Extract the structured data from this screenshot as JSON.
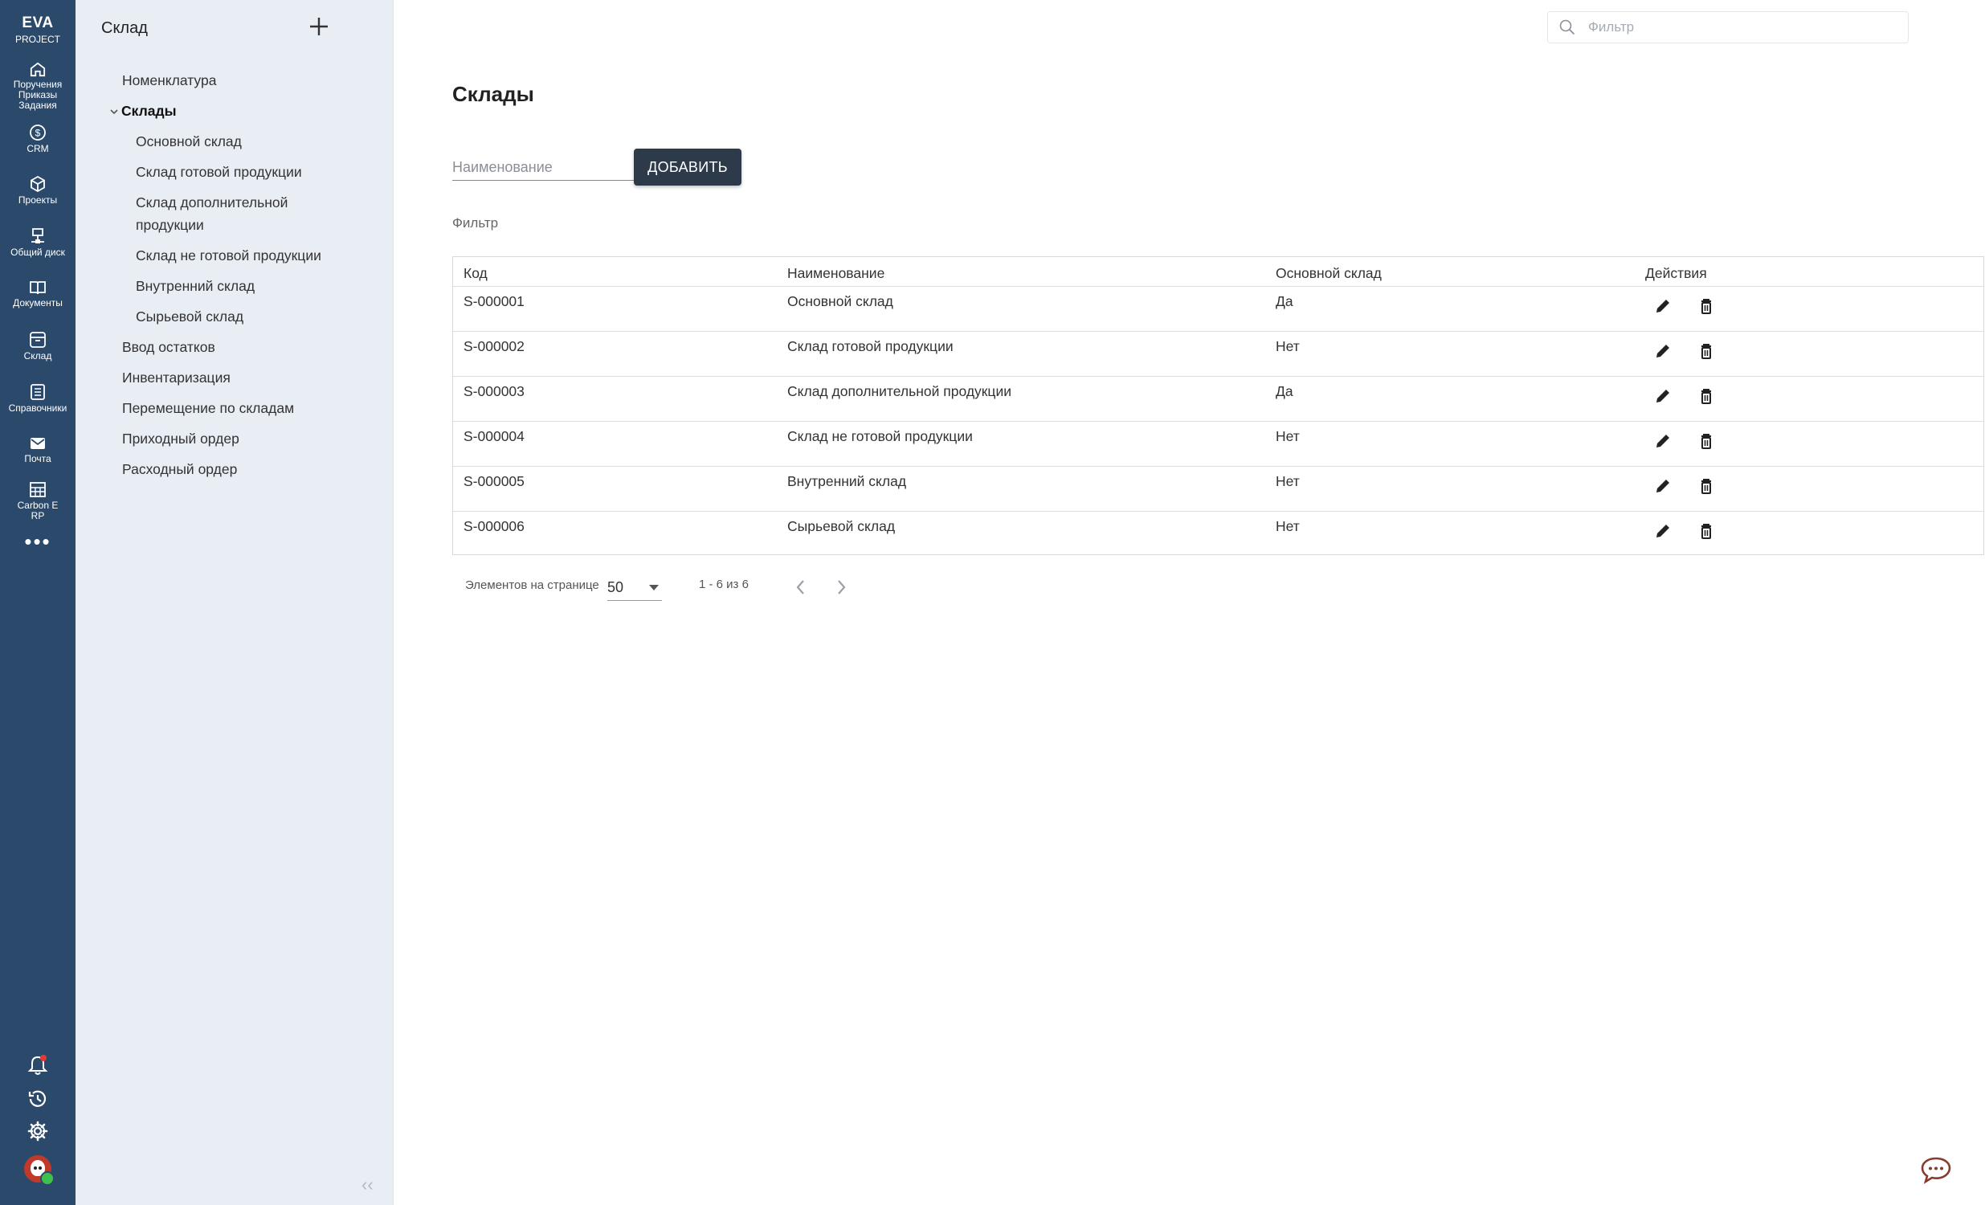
{
  "brand": {
    "line1": "EVA",
    "line2": "PROJECT"
  },
  "rail": [
    {
      "label": "Поручения Приказы Задания",
      "icon": "home-icon"
    },
    {
      "label": "CRM",
      "icon": "dollar-icon"
    },
    {
      "label": "Проекты",
      "icon": "cube-icon"
    },
    {
      "label": "Общий диск",
      "icon": "network-drive-icon"
    },
    {
      "label": "Документы",
      "icon": "book-icon"
    },
    {
      "label": "Склад",
      "icon": "warehouse-icon"
    },
    {
      "label": "Справочники",
      "icon": "reference-book-icon"
    },
    {
      "label": "Почта",
      "icon": "mail-icon"
    },
    {
      "label": "Carbon E RP",
      "icon": "building-icon"
    }
  ],
  "sidebar": {
    "title": "Склад",
    "items": [
      {
        "label": "Номенклатура"
      },
      {
        "label": "Склады"
      },
      {
        "label": "Основной склад"
      },
      {
        "label": "Склад готовой продукции"
      },
      {
        "label": "Склад дополнительной продукции"
      },
      {
        "label": "Склад не готовой продукции"
      },
      {
        "label": "Внутренний склад"
      },
      {
        "label": "Сырьевой склад"
      },
      {
        "label": "Ввод остатков"
      },
      {
        "label": "Инвентаризация"
      },
      {
        "label": "Перемещение по складам"
      },
      {
        "label": "Приходный ордер"
      },
      {
        "label": "Расходный ордер"
      }
    ],
    "collapse": "‹‹"
  },
  "search": {
    "placeholder": "Фильтр"
  },
  "main": {
    "title": "Склады",
    "name_placeholder": "Наименование",
    "add_button": "ДОБАВИТЬ",
    "filter_label": "Фильтр"
  },
  "table": {
    "headers": [
      "Код",
      "Наименование",
      "Основной склад",
      "Действия"
    ],
    "rows": [
      {
        "code": "S-000001",
        "name": "Основной склад",
        "main": "Да"
      },
      {
        "code": "S-000002",
        "name": "Склад готовой продукции",
        "main": "Нет"
      },
      {
        "code": "S-000003",
        "name": "Склад дополнительной продукции",
        "main": "Да"
      },
      {
        "code": "S-000004",
        "name": "Склад не готовой продукции",
        "main": "Нет"
      },
      {
        "code": "S-000005",
        "name": "Внутренний склад",
        "main": "Нет"
      },
      {
        "code": "S-000006",
        "name": "Сырьевой склад",
        "main": "Нет"
      }
    ]
  },
  "pagination": {
    "per_page_label": "Элементов на странице",
    "per_page_value": "50",
    "range": "1 - 6 из 6"
  },
  "colors": {
    "rail": "#2b4a6b",
    "sidebar": "#e9eef5",
    "button": "#2c3a4a",
    "chat": "#8b3a2f"
  }
}
